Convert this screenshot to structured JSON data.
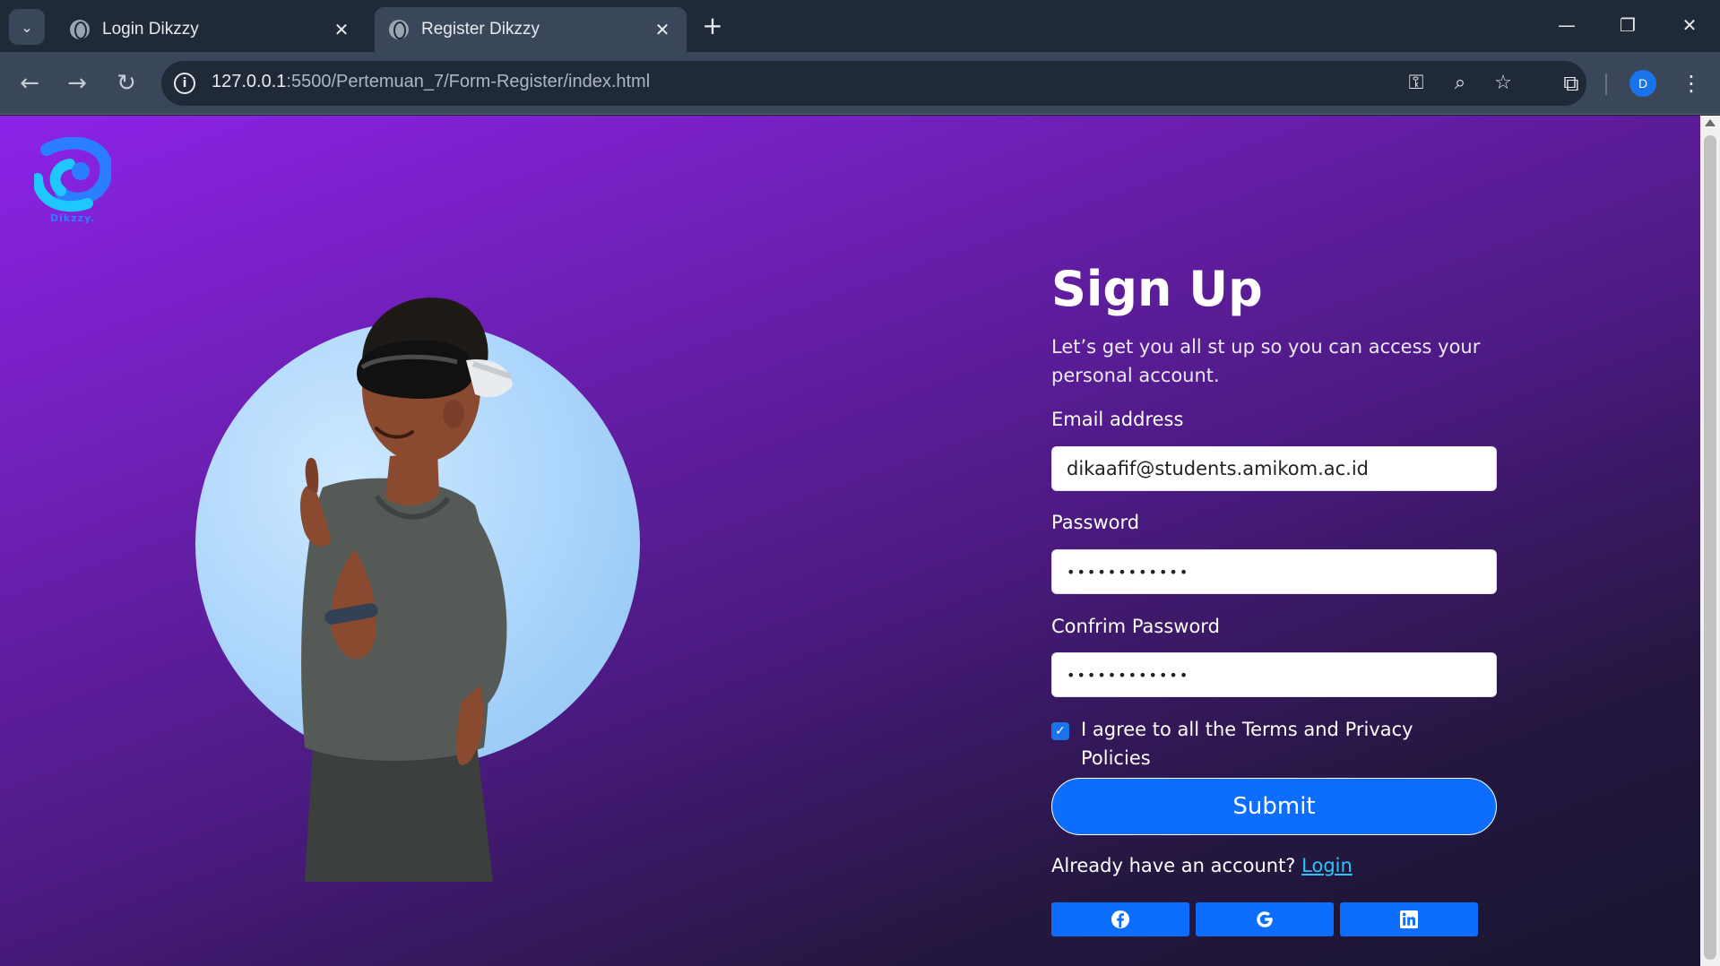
{
  "browser": {
    "tabs": [
      {
        "title": "Login Dikzzy",
        "active": false
      },
      {
        "title": "Register Dikzzy",
        "active": true
      }
    ],
    "url_host": "127.0.0.1",
    "url_path": ":5500/Pertemuan_7/Form-Register/index.html",
    "profile_initial": "D",
    "icons": [
      "tab-search-icon",
      "globe-icon",
      "close-icon",
      "new-tab-icon",
      "minimize-icon",
      "restore-icon",
      "window-close-icon",
      "back-icon",
      "forward-icon",
      "reload-icon",
      "site-info-icon",
      "password-key-icon",
      "zoom-icon",
      "bookmark-star-icon",
      "extensions-icon",
      "menu-icon"
    ]
  },
  "page": {
    "logo_text": "Dikzzy.",
    "title": "Sign Up",
    "subtitle": "Let’s get you all st up so you can access your personal account.",
    "email_label": "Email address",
    "email_value": "dikaafif@students.amikom.ac.id",
    "password_label": "Password",
    "password_value": "••••••••••••",
    "confirm_label": "Confrim Password",
    "confirm_value": "••••••••••••",
    "terms_checked": true,
    "terms_text": "I agree to all the Terms and Privacy Policies",
    "submit_label": "Submit",
    "already_text": "Already have an account?",
    "login_link": "Login",
    "social_buttons": [
      "facebook-icon",
      "google-icon",
      "linkedin-icon"
    ]
  },
  "colors": {
    "gradient_start": "#8c23e8",
    "gradient_end": "#191530",
    "primary_button": "#0d6efd",
    "link": "#2dc3ff",
    "hero_circle": "#a9d4fb"
  }
}
